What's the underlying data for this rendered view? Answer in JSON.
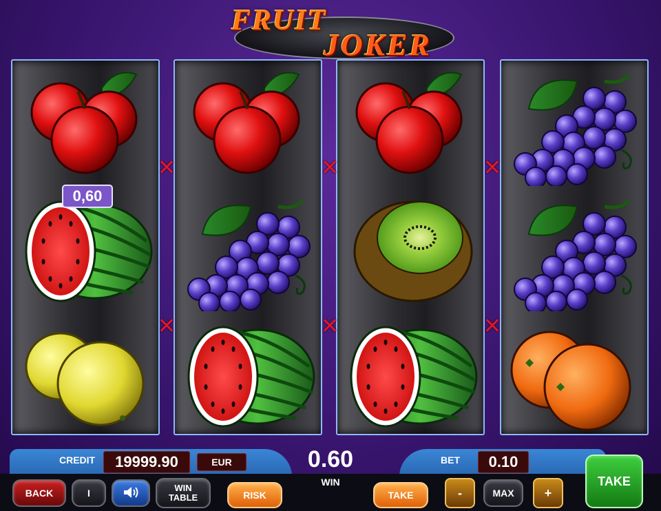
{
  "logo": {
    "line1": "FRUIT",
    "line2": "JOKER"
  },
  "reels": [
    [
      "apple",
      "watermelon",
      "lemon"
    ],
    [
      "apple",
      "grapes",
      "watermelon"
    ],
    [
      "apple",
      "kiwi",
      "watermelon"
    ],
    [
      "grapes",
      "grapes",
      "orange"
    ]
  ],
  "payline_marker": "✕",
  "win_badge": "0,60",
  "panel": {
    "credit_label": "CREDIT",
    "credit_value": "19999.90",
    "currency": "EUR",
    "win_value": "0.60",
    "win_label": "WIN",
    "bet_label": "BET",
    "bet_value": "0.10"
  },
  "buttons": {
    "back": "BACK",
    "info": "I",
    "sound_icon": "speaker-icon",
    "win_table_line1": "WIN",
    "win_table_line2": "TABLE",
    "risk": "RISK",
    "take": "TAKE",
    "minus": "-",
    "max": "MAX",
    "plus": "+",
    "take_big": "TAKE"
  },
  "colors": {
    "background": "#3a1670",
    "reel_border": "#8fb8ff",
    "payline_marker": "#e0162a",
    "take_button": "#2ea82e",
    "risk_button": "#f08a2a"
  }
}
